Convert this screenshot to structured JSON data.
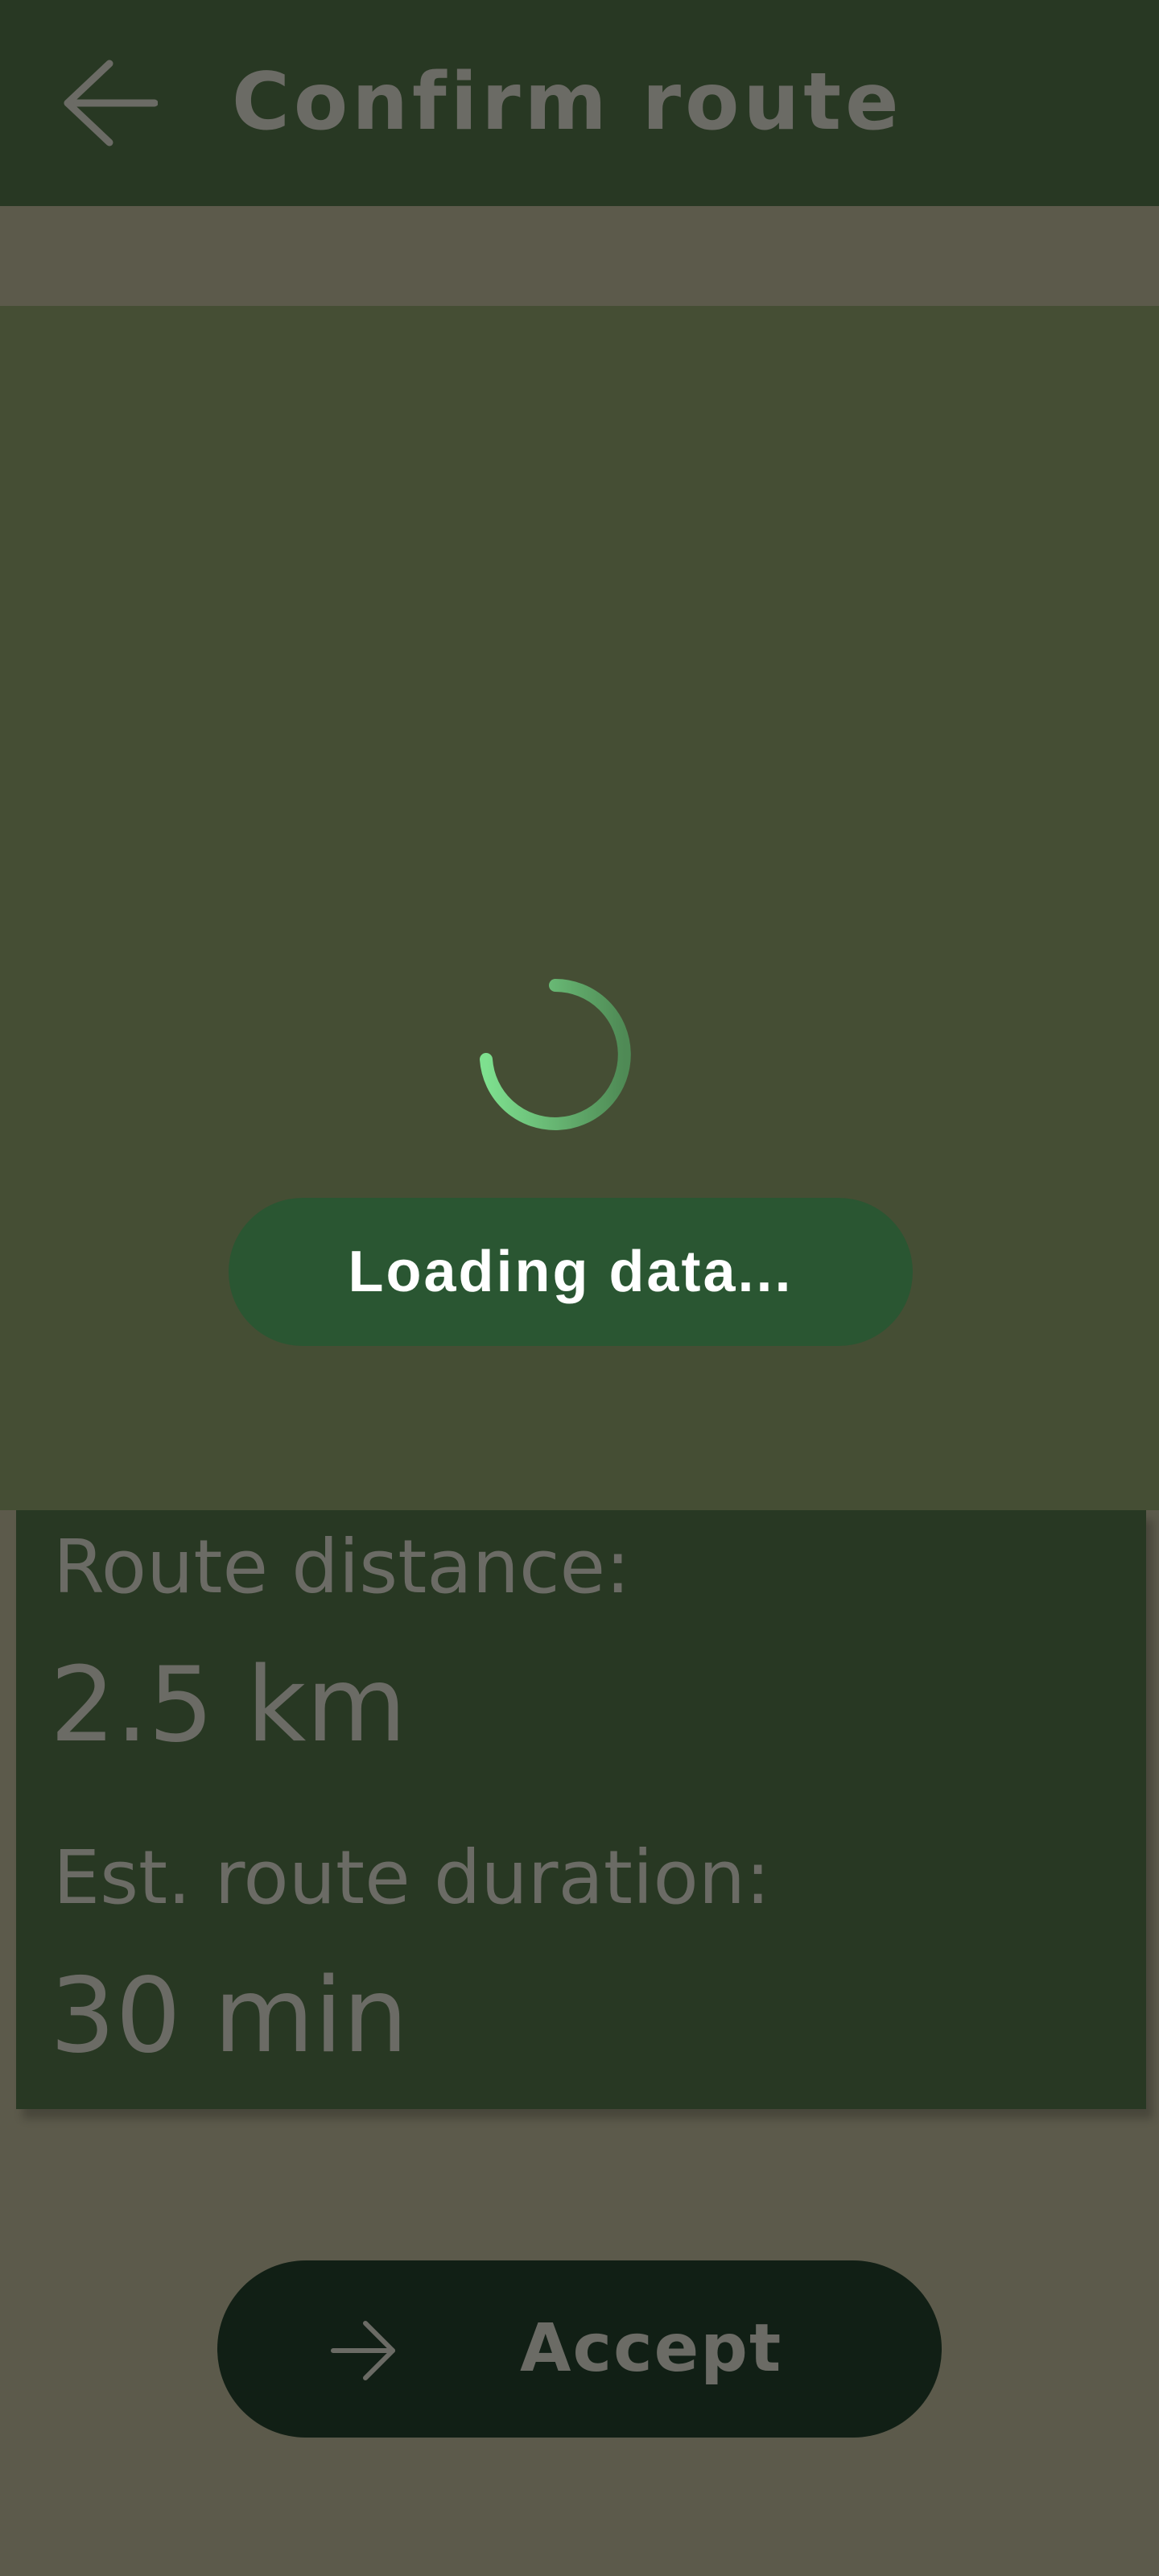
{
  "header": {
    "title": "Confirm route",
    "back_icon": "arrow-left-icon"
  },
  "map": {
    "loading_text": "Loading data...",
    "spinner_icon": "loading-spinner-icon",
    "spinner_color": "#7ee08f"
  },
  "route_info": {
    "distance_label": "Route distance:",
    "distance_value": "2.5 km",
    "duration_label": "Est. route duration:",
    "duration_value": "30 min"
  },
  "actions": {
    "accept_label": "Accept",
    "accept_icon": "arrow-right-icon"
  },
  "colors": {
    "top_bar": "#283823",
    "background": "#5c5a4b",
    "map_overlay": "#454e34",
    "loading_pill": "#2a5632",
    "card": "#283823",
    "accept_button": "#111f15",
    "muted_text": "#6b6b65"
  }
}
